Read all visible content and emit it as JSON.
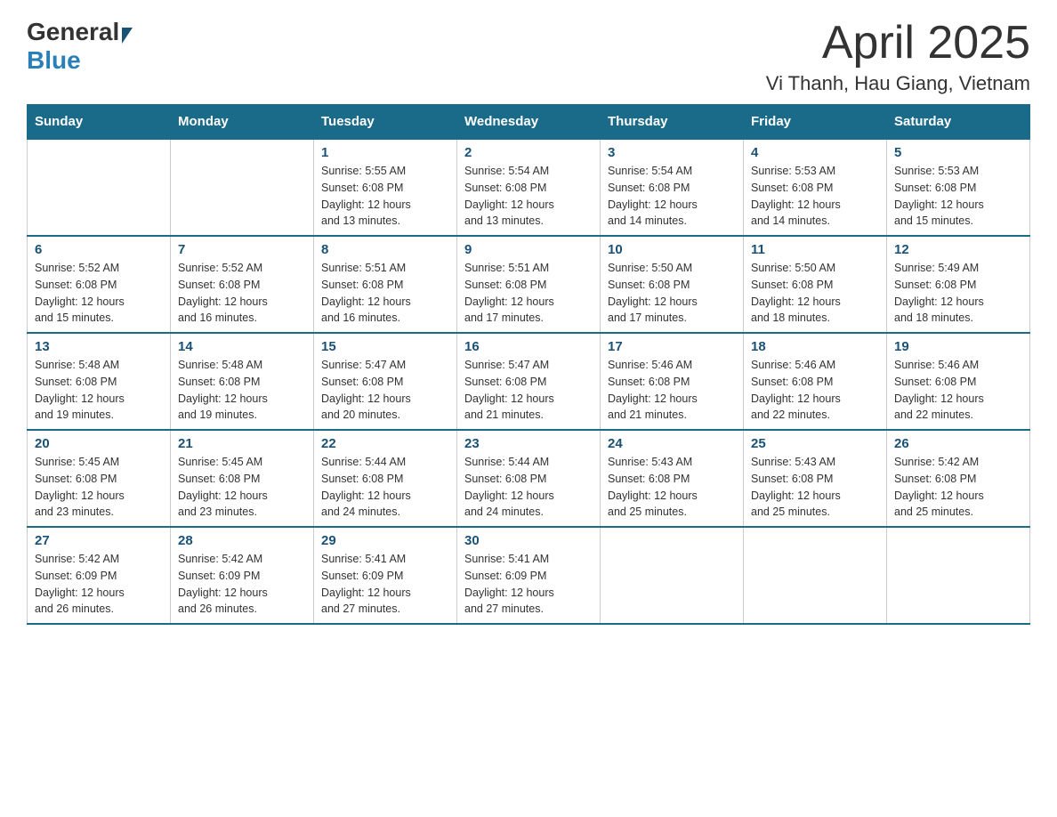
{
  "header": {
    "logo_general": "General",
    "logo_blue": "Blue",
    "title": "April 2025",
    "subtitle": "Vi Thanh, Hau Giang, Vietnam"
  },
  "weekdays": [
    "Sunday",
    "Monday",
    "Tuesday",
    "Wednesday",
    "Thursday",
    "Friday",
    "Saturday"
  ],
  "weeks": [
    [
      {
        "day": "",
        "info": ""
      },
      {
        "day": "",
        "info": ""
      },
      {
        "day": "1",
        "info": "Sunrise: 5:55 AM\nSunset: 6:08 PM\nDaylight: 12 hours\nand 13 minutes."
      },
      {
        "day": "2",
        "info": "Sunrise: 5:54 AM\nSunset: 6:08 PM\nDaylight: 12 hours\nand 13 minutes."
      },
      {
        "day": "3",
        "info": "Sunrise: 5:54 AM\nSunset: 6:08 PM\nDaylight: 12 hours\nand 14 minutes."
      },
      {
        "day": "4",
        "info": "Sunrise: 5:53 AM\nSunset: 6:08 PM\nDaylight: 12 hours\nand 14 minutes."
      },
      {
        "day": "5",
        "info": "Sunrise: 5:53 AM\nSunset: 6:08 PM\nDaylight: 12 hours\nand 15 minutes."
      }
    ],
    [
      {
        "day": "6",
        "info": "Sunrise: 5:52 AM\nSunset: 6:08 PM\nDaylight: 12 hours\nand 15 minutes."
      },
      {
        "day": "7",
        "info": "Sunrise: 5:52 AM\nSunset: 6:08 PM\nDaylight: 12 hours\nand 16 minutes."
      },
      {
        "day": "8",
        "info": "Sunrise: 5:51 AM\nSunset: 6:08 PM\nDaylight: 12 hours\nand 16 minutes."
      },
      {
        "day": "9",
        "info": "Sunrise: 5:51 AM\nSunset: 6:08 PM\nDaylight: 12 hours\nand 17 minutes."
      },
      {
        "day": "10",
        "info": "Sunrise: 5:50 AM\nSunset: 6:08 PM\nDaylight: 12 hours\nand 17 minutes."
      },
      {
        "day": "11",
        "info": "Sunrise: 5:50 AM\nSunset: 6:08 PM\nDaylight: 12 hours\nand 18 minutes."
      },
      {
        "day": "12",
        "info": "Sunrise: 5:49 AM\nSunset: 6:08 PM\nDaylight: 12 hours\nand 18 minutes."
      }
    ],
    [
      {
        "day": "13",
        "info": "Sunrise: 5:48 AM\nSunset: 6:08 PM\nDaylight: 12 hours\nand 19 minutes."
      },
      {
        "day": "14",
        "info": "Sunrise: 5:48 AM\nSunset: 6:08 PM\nDaylight: 12 hours\nand 19 minutes."
      },
      {
        "day": "15",
        "info": "Sunrise: 5:47 AM\nSunset: 6:08 PM\nDaylight: 12 hours\nand 20 minutes."
      },
      {
        "day": "16",
        "info": "Sunrise: 5:47 AM\nSunset: 6:08 PM\nDaylight: 12 hours\nand 21 minutes."
      },
      {
        "day": "17",
        "info": "Sunrise: 5:46 AM\nSunset: 6:08 PM\nDaylight: 12 hours\nand 21 minutes."
      },
      {
        "day": "18",
        "info": "Sunrise: 5:46 AM\nSunset: 6:08 PM\nDaylight: 12 hours\nand 22 minutes."
      },
      {
        "day": "19",
        "info": "Sunrise: 5:46 AM\nSunset: 6:08 PM\nDaylight: 12 hours\nand 22 minutes."
      }
    ],
    [
      {
        "day": "20",
        "info": "Sunrise: 5:45 AM\nSunset: 6:08 PM\nDaylight: 12 hours\nand 23 minutes."
      },
      {
        "day": "21",
        "info": "Sunrise: 5:45 AM\nSunset: 6:08 PM\nDaylight: 12 hours\nand 23 minutes."
      },
      {
        "day": "22",
        "info": "Sunrise: 5:44 AM\nSunset: 6:08 PM\nDaylight: 12 hours\nand 24 minutes."
      },
      {
        "day": "23",
        "info": "Sunrise: 5:44 AM\nSunset: 6:08 PM\nDaylight: 12 hours\nand 24 minutes."
      },
      {
        "day": "24",
        "info": "Sunrise: 5:43 AM\nSunset: 6:08 PM\nDaylight: 12 hours\nand 25 minutes."
      },
      {
        "day": "25",
        "info": "Sunrise: 5:43 AM\nSunset: 6:08 PM\nDaylight: 12 hours\nand 25 minutes."
      },
      {
        "day": "26",
        "info": "Sunrise: 5:42 AM\nSunset: 6:08 PM\nDaylight: 12 hours\nand 25 minutes."
      }
    ],
    [
      {
        "day": "27",
        "info": "Sunrise: 5:42 AM\nSunset: 6:09 PM\nDaylight: 12 hours\nand 26 minutes."
      },
      {
        "day": "28",
        "info": "Sunrise: 5:42 AM\nSunset: 6:09 PM\nDaylight: 12 hours\nand 26 minutes."
      },
      {
        "day": "29",
        "info": "Sunrise: 5:41 AM\nSunset: 6:09 PM\nDaylight: 12 hours\nand 27 minutes."
      },
      {
        "day": "30",
        "info": "Sunrise: 5:41 AM\nSunset: 6:09 PM\nDaylight: 12 hours\nand 27 minutes."
      },
      {
        "day": "",
        "info": ""
      },
      {
        "day": "",
        "info": ""
      },
      {
        "day": "",
        "info": ""
      }
    ]
  ]
}
